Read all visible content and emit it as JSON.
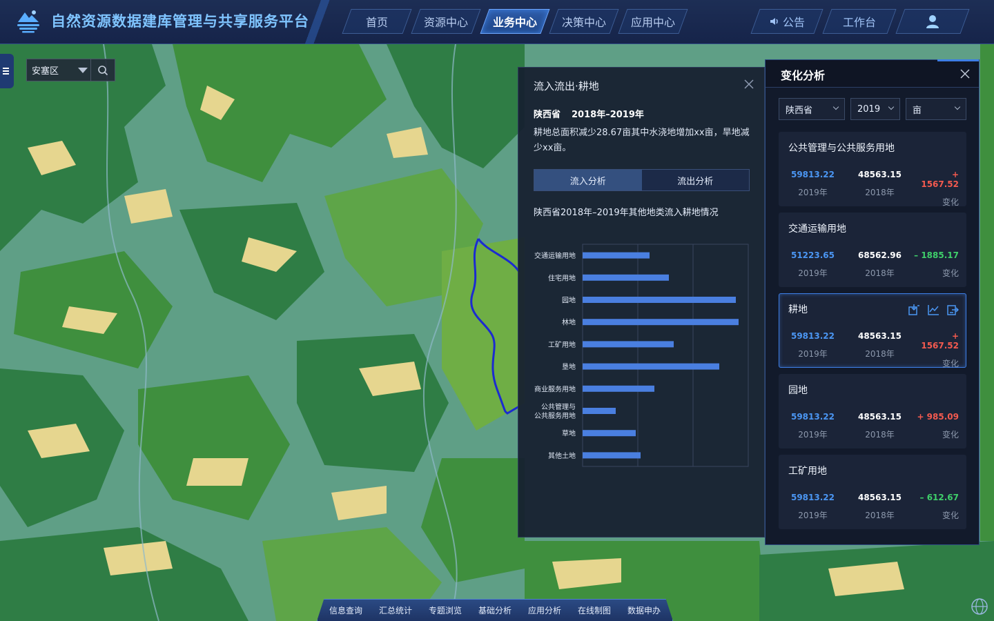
{
  "app": {
    "title": "自然资源数据建库管理与共享服务平台"
  },
  "nav": {
    "tabs": [
      {
        "label": "首页",
        "active": false
      },
      {
        "label": "资源中心",
        "active": false
      },
      {
        "label": "业务中心",
        "active": true
      },
      {
        "label": "决策中心",
        "active": false
      },
      {
        "label": "应用中心",
        "active": false
      }
    ]
  },
  "tools": {
    "notice": "公告",
    "workbench": "工作台",
    "user_icon": "user-icon"
  },
  "search": {
    "region": "安塞区"
  },
  "flow_panel": {
    "title": "流入流出·耕地",
    "province": "陕西省",
    "period": "2018年–2019年",
    "description": "耕地总面积减少28.67亩其中水浇地增加xx亩，旱地减少xx亩。",
    "tabs": [
      "流入分析",
      "流出分析"
    ],
    "chart_title": "陕西省2018年–2019年其他地类流入耕地情况"
  },
  "chart_data": {
    "type": "bar",
    "orientation": "horizontal",
    "categories": [
      "交通运输用地",
      "住宅用地",
      "园地",
      "林地",
      "工矿用地",
      "垦地",
      "商业服务用地",
      "公共管理与公共服务用地",
      "草地",
      "其他土地"
    ],
    "category_labels": [
      [
        "交通运输用地"
      ],
      [
        "住宅用地"
      ],
      [
        "园地"
      ],
      [
        "林地"
      ],
      [
        "工矿用地"
      ],
      [
        "垦地"
      ],
      [
        "商业服务用地"
      ],
      [
        "公共管理与",
        "公共服务用地"
      ],
      [
        "草地"
      ],
      [
        "其他土地"
      ]
    ],
    "values": [
      97,
      125,
      222,
      226,
      132,
      198,
      104,
      48,
      77,
      84
    ],
    "xlim": [
      0,
      240
    ],
    "grid": true,
    "bar_color": "#4a7fe0"
  },
  "change_panel": {
    "title": "变化分析",
    "filters": {
      "province": "陕西省",
      "year": "2019",
      "unit": "亩"
    },
    "labels": {
      "y2019": "2019年",
      "y2018": "2018年",
      "change": "变化"
    },
    "cards": [
      {
        "name": "公共管理与公共服务用地",
        "v2019": "59813.22",
        "v2018": "48563.15",
        "change": "+ 1567.52",
        "trend": "up",
        "selected": false
      },
      {
        "name": "交通运输用地",
        "v2019": "51223.65",
        "v2018": "68562.96",
        "change": "– 1885.17",
        "trend": "down",
        "selected": false
      },
      {
        "name": "耕地",
        "v2019": "59813.22",
        "v2018": "48563.15",
        "change": "+ 1567.52",
        "trend": "up",
        "selected": true
      },
      {
        "name": "园地",
        "v2019": "59813.22",
        "v2018": "48563.15",
        "change": "+ 985.09",
        "trend": "up",
        "selected": false
      },
      {
        "name": "工矿用地",
        "v2019": "59813.22",
        "v2018": "48563.15",
        "change": "– 612.67",
        "trend": "down",
        "selected": false
      }
    ],
    "card_icons": [
      "import-icon",
      "line-chart-icon",
      "export-icon"
    ]
  },
  "bottom_toolbar": {
    "items": [
      "信息查询",
      "汇总统计",
      "专题浏览",
      "基础分析",
      "应用分析",
      "在线制图",
      "数据申办"
    ]
  },
  "colors": {
    "accent": "#3d7ee6",
    "up": "#f45a4f",
    "down": "#3fcf6a",
    "value2019": "#4b96f3"
  }
}
